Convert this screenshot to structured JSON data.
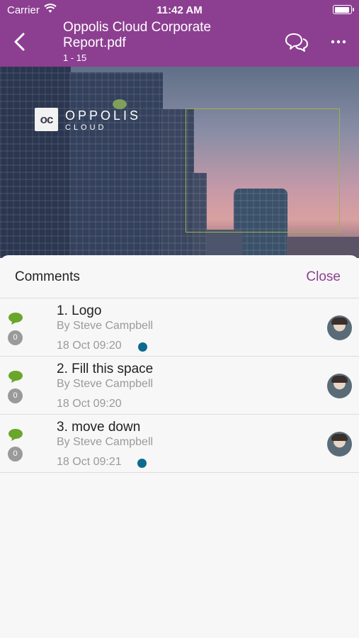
{
  "status_bar": {
    "carrier": "Carrier",
    "time": "11:42 AM"
  },
  "nav": {
    "title": "Oppolis Cloud Corporate Report.pdf",
    "pages": "1 - 15",
    "back_icon": "chevron-left-icon",
    "comments_icon": "chat-bubbles-icon",
    "more_icon": "more-horizontal-icon"
  },
  "preview": {
    "logo_mark": "oc",
    "logo_text": "OPPOLIS",
    "logo_sub": "CLOUD"
  },
  "comments_panel": {
    "title": "Comments",
    "close_label": "Close",
    "items": [
      {
        "title": "1. Logo",
        "author": "By Steve Campbell",
        "date": "18 Oct 09:20",
        "count": "0",
        "unread": true
      },
      {
        "title": "2. Fill this space",
        "author": "By Steve Campbell",
        "date": "18 Oct 09:20",
        "count": "0",
        "unread": false
      },
      {
        "title": "3. move down",
        "author": "By Steve Campbell",
        "date": "18 Oct 09:21",
        "count": "0",
        "unread": true
      }
    ]
  },
  "colors": {
    "brand_purple": "#8c3f91",
    "comment_green": "#6aa62a",
    "unread_blue": "#0d6a8f",
    "annotation_green": "#9bb24a"
  }
}
